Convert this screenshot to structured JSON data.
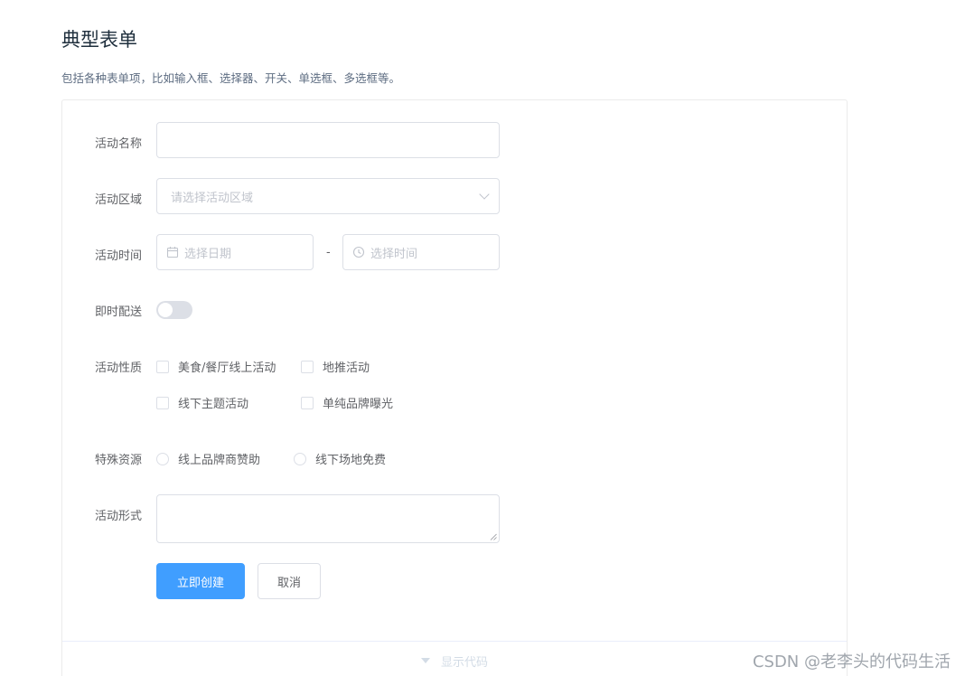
{
  "page": {
    "title": "典型表单",
    "description": "包括各种表单项，比如输入框、选择器、开关、单选框、多选框等。"
  },
  "form": {
    "name_label": "活动名称",
    "name_value": "",
    "region_label": "活动区域",
    "region_placeholder": "请选择活动区域",
    "time_label": "活动时间",
    "date_placeholder": "选择日期",
    "time_separator": "-",
    "time_placeholder": "选择时间",
    "delivery_label": "即时配送",
    "delivery_on": false,
    "type_label": "活动性质",
    "type_options": [
      "美食/餐厅线上活动",
      "地推活动",
      "线下主题活动",
      "单纯品牌曝光"
    ],
    "resource_label": "特殊资源",
    "resource_options": [
      "线上品牌商赞助",
      "线下场地免费"
    ],
    "desc_label": "活动形式",
    "desc_value": "",
    "submit_label": "立即创建",
    "cancel_label": "取消"
  },
  "footer": {
    "toggle_label": "显示代码"
  },
  "watermark": "CSDN @老李头的代码生活",
  "icons": {
    "date": "calendar-icon",
    "time": "clock-icon",
    "select": "chevron-down-icon",
    "footer": "caret-down-icon"
  },
  "colors": {
    "primary": "#409eff",
    "border": "#dcdfe6",
    "placeholder": "#c0c4cc",
    "text": "#606266",
    "title": "#1f2f3d"
  }
}
